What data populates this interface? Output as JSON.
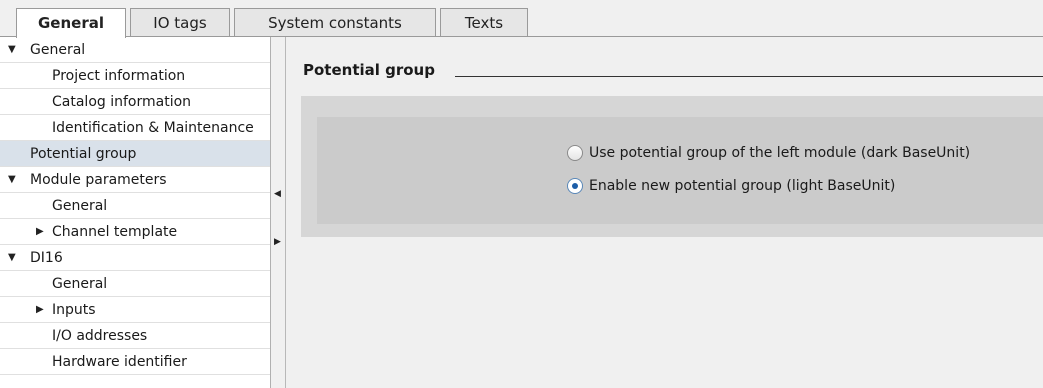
{
  "tabs": [
    {
      "label": "General",
      "active": true
    },
    {
      "label": "IO tags",
      "active": false
    },
    {
      "label": "System constants",
      "active": false
    },
    {
      "label": "Texts",
      "active": false
    }
  ],
  "tree": {
    "items": [
      {
        "label": "General",
        "expander": "expanded",
        "level": 0
      },
      {
        "label": "Project information",
        "level": 1
      },
      {
        "label": "Catalog information",
        "level": 1
      },
      {
        "label": "Identification & Maintenance",
        "level": 1
      },
      {
        "label": "Potential group",
        "level": 0,
        "selected": true
      },
      {
        "label": "Module parameters",
        "expander": "expanded",
        "level": 0
      },
      {
        "label": "General",
        "level": 1
      },
      {
        "label": "Channel template",
        "expander": "collapsed",
        "level": 1
      },
      {
        "label": "DI16",
        "expander": "expanded",
        "level": 0
      },
      {
        "label": "General",
        "level": 1
      },
      {
        "label": "Inputs",
        "expander": "collapsed",
        "level": 1
      },
      {
        "label": "I/O addresses",
        "level": 1
      },
      {
        "label": "Hardware identifier",
        "level": 1
      }
    ]
  },
  "section": {
    "title": "Potential group",
    "options": [
      {
        "label": "Use potential group of the left module (dark BaseUnit)",
        "checked": false
      },
      {
        "label": "Enable new potential group (light BaseUnit)",
        "checked": true
      }
    ]
  },
  "colors": {
    "selected_row": "#d9e1ea",
    "radio_accent": "#1c5ea8",
    "panel": "#cbcbcb"
  }
}
